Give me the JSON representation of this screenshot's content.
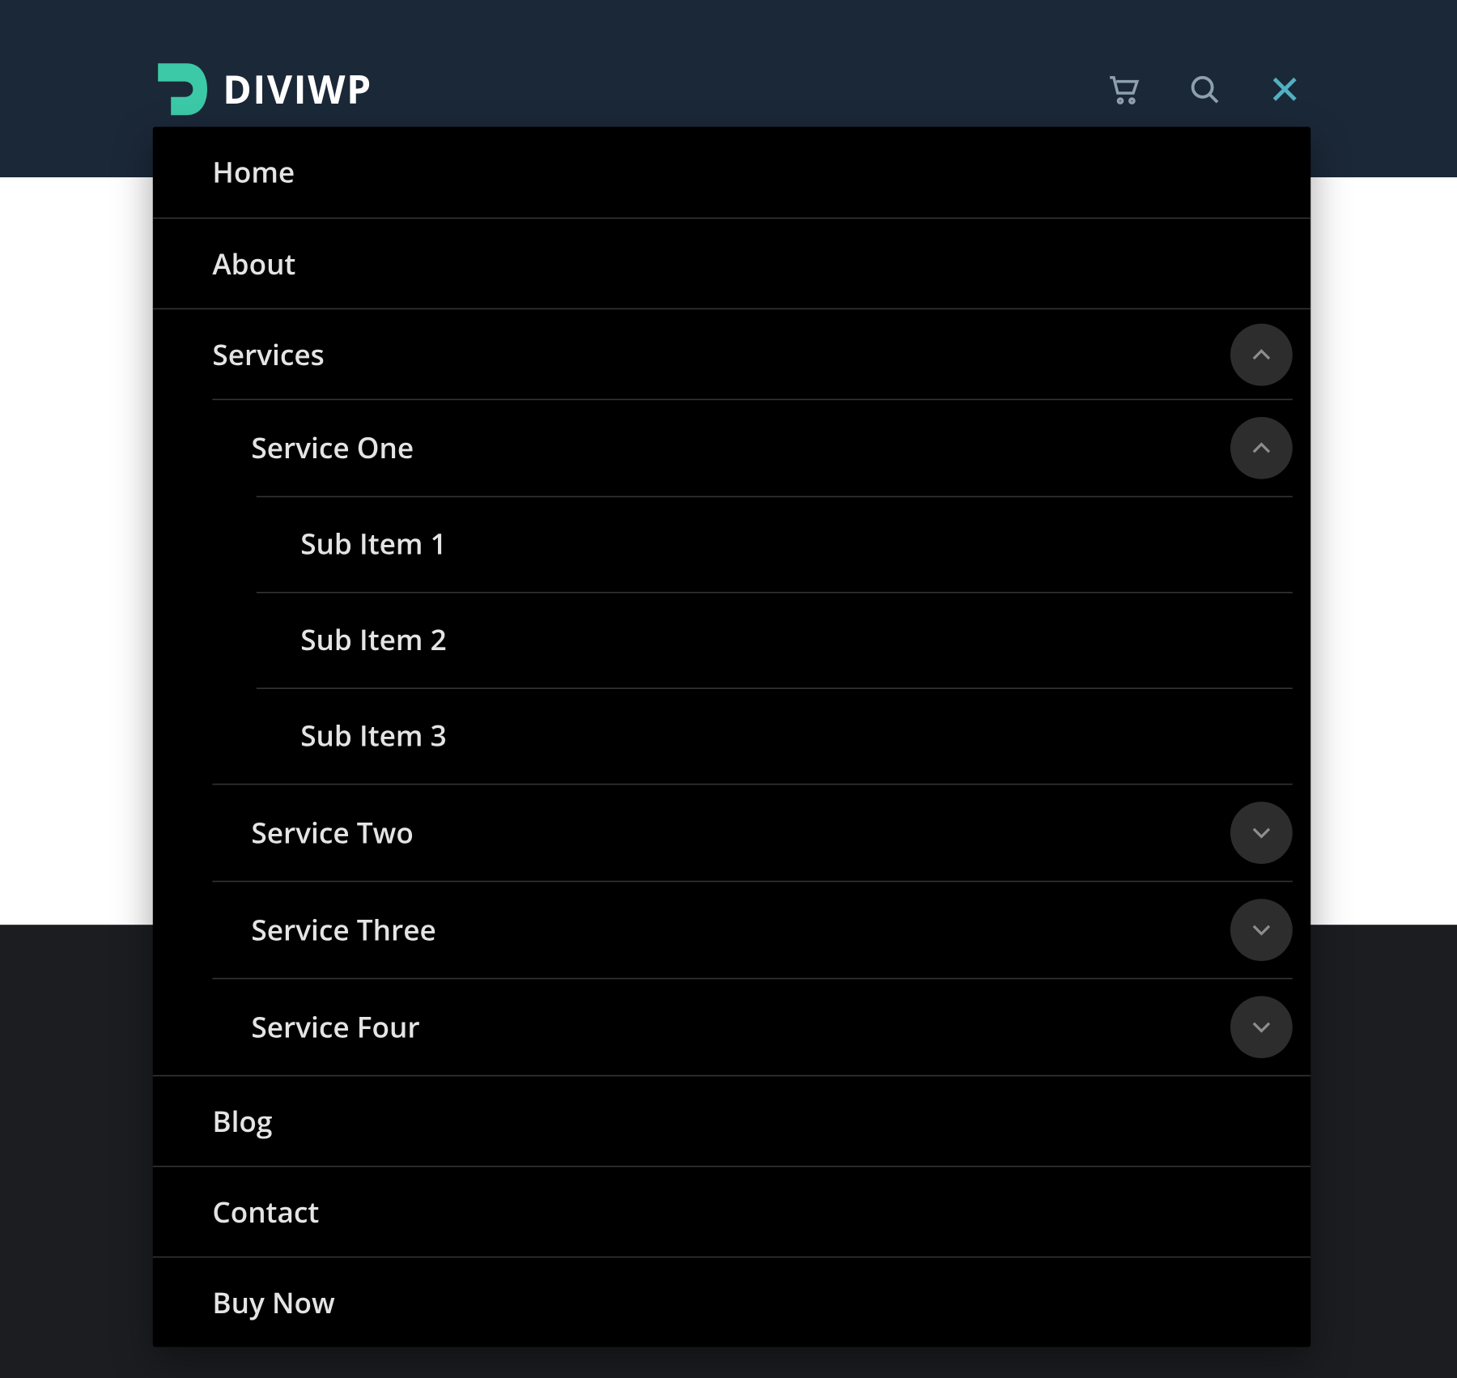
{
  "brand": {
    "name": "DIVIWP",
    "accent_color": "#3cc9a7"
  },
  "header": {
    "icons": {
      "cart": "cart-icon",
      "search": "search-icon",
      "close": "close-icon"
    }
  },
  "menu": {
    "items": [
      {
        "label": "Home",
        "level": 0,
        "expandable": false
      },
      {
        "label": "About",
        "level": 0,
        "expandable": false
      },
      {
        "label": "Services",
        "level": 0,
        "expandable": true,
        "expanded": true
      },
      {
        "label": "Service One",
        "level": 1,
        "expandable": true,
        "expanded": true
      },
      {
        "label": "Sub Item 1",
        "level": 2,
        "expandable": false
      },
      {
        "label": "Sub Item 2",
        "level": 2,
        "expandable": false
      },
      {
        "label": "Sub Item 3",
        "level": 2,
        "expandable": false
      },
      {
        "label": "Service Two",
        "level": 1,
        "expandable": true,
        "expanded": false
      },
      {
        "label": "Service Three",
        "level": 1,
        "expandable": true,
        "expanded": false
      },
      {
        "label": "Service Four",
        "level": 1,
        "expandable": true,
        "expanded": false
      },
      {
        "label": "Blog",
        "level": 0,
        "expandable": false
      },
      {
        "label": "Contact",
        "level": 0,
        "expandable": false
      },
      {
        "label": "Buy Now",
        "level": 0,
        "expandable": false
      }
    ]
  }
}
